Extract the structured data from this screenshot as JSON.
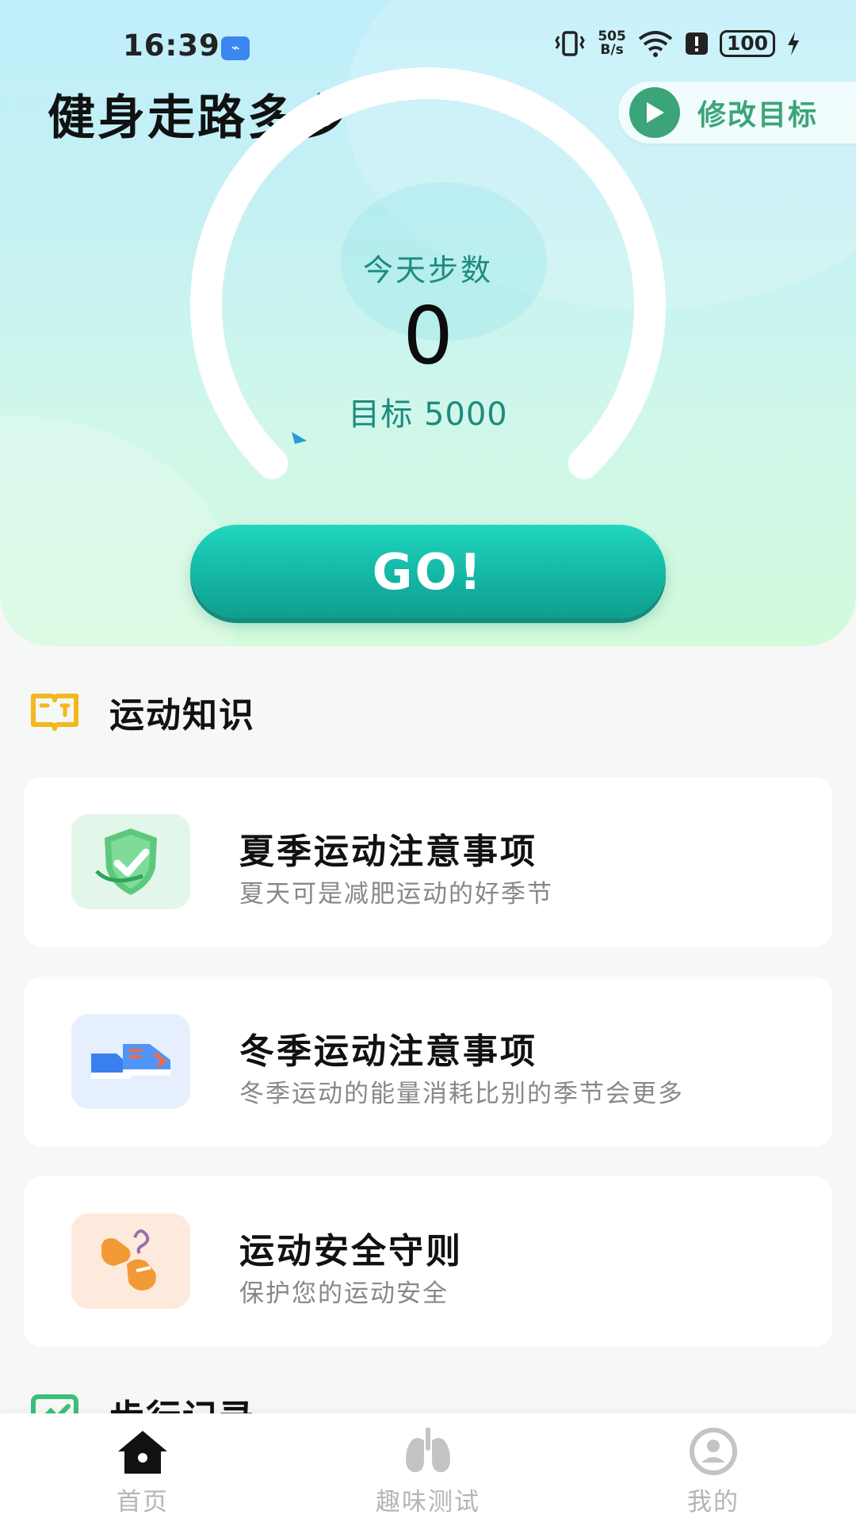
{
  "status_bar": {
    "time": "16:39",
    "net_speed_top": "505",
    "net_speed_bottom": "B/s",
    "battery": "100"
  },
  "header": {
    "title": "健身走路多多",
    "edit_goal_label": "修改目标"
  },
  "steps": {
    "today_label": "今天步数",
    "count": "0",
    "goal_text": "目标 5000",
    "progress": 0
  },
  "go_button_label": "GO!",
  "knowledge": {
    "title": "运动知识",
    "cards": [
      {
        "title": "夏季运动注意事项",
        "desc": "夏天可是减肥运动的好季节",
        "icon": "shield-check-icon"
      },
      {
        "title": "冬季运动注意事项",
        "desc": "冬季运动的能量消耗比别的季节会更多",
        "icon": "sneakers-icon"
      },
      {
        "title": "运动安全守则",
        "desc": "保护您的运动安全",
        "icon": "gloves-icon"
      }
    ]
  },
  "records": {
    "title": "步行记录"
  },
  "bottom_nav": {
    "items": [
      {
        "label": "首页",
        "icon": "home-icon",
        "active": true
      },
      {
        "label": "趣味测试",
        "icon": "lungs-icon",
        "active": false
      },
      {
        "label": "我的",
        "icon": "profile-icon",
        "active": false
      }
    ]
  },
  "colors": {
    "accent": "#1e8a7d",
    "go_button": "#14b3a2",
    "edit_goal": "#3ba579"
  }
}
